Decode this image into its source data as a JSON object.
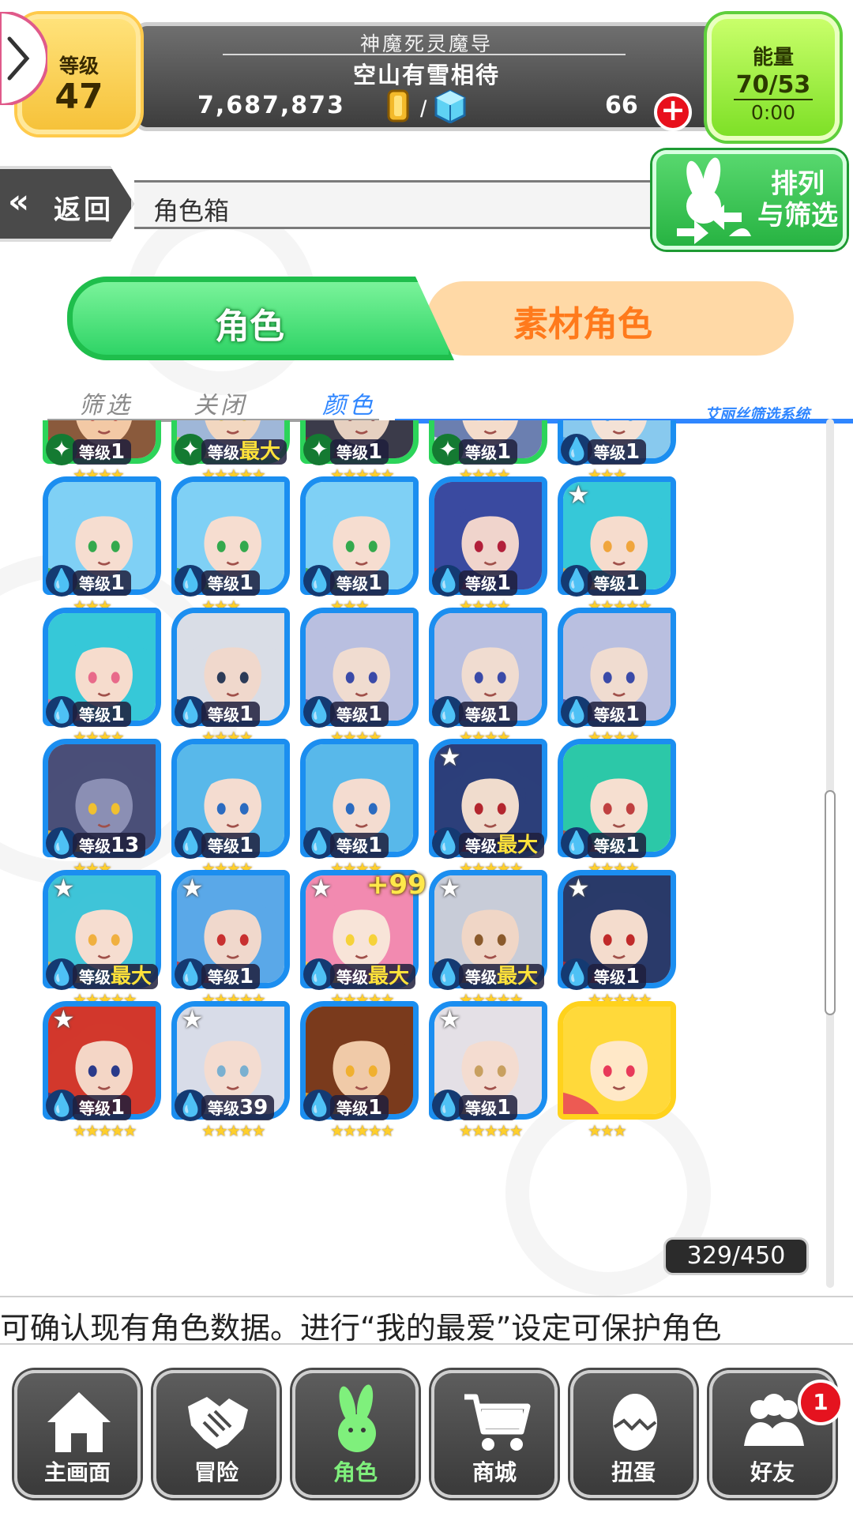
{
  "header": {
    "level_label": "等级",
    "level_value": "47",
    "player_title": "神魔死灵魔导",
    "player_name": "空山有雪相待",
    "coins": "7,687,873",
    "separator": "/",
    "gems": "66",
    "energy_label": "能量",
    "energy_value": "70/53",
    "energy_timer": "0:00"
  },
  "nav_bar": {
    "back_label": "返回",
    "page_title": "角色箱",
    "sort_label_1": "排列",
    "sort_label_2": "与筛选"
  },
  "tabs": {
    "characters": "角色",
    "material": "素材角色"
  },
  "filters": {
    "filter": "筛选",
    "close": "关闭",
    "color": "颜色",
    "system": "艾丽丝筛选系统"
  },
  "units": [
    {
      "lv_label": "等级",
      "lv": "1",
      "stars": "★★★★",
      "frame": "green",
      "elem": "leaf",
      "max": false,
      "rank": false
    },
    {
      "lv_label": "等级",
      "lv": "最大",
      "stars": "★★★★★",
      "frame": "green",
      "elem": "leaf",
      "max": true,
      "rank": false
    },
    {
      "lv_label": "等级",
      "lv": "1",
      "stars": "★★★★★",
      "frame": "green",
      "elem": "leaf",
      "max": false,
      "rank": false
    },
    {
      "lv_label": "等级",
      "lv": "1",
      "stars": "★★★★",
      "frame": "green",
      "elem": "leaf",
      "max": false,
      "rank": false
    },
    {
      "lv_label": "等级",
      "lv": "1",
      "stars": "★★★",
      "frame": "blue",
      "elem": "water",
      "max": false,
      "rank": false
    },
    {
      "lv_label": "等级",
      "lv": "1",
      "stars": "★★★",
      "frame": "blue",
      "elem": "water",
      "max": false,
      "rank": false
    },
    {
      "lv_label": "等级",
      "lv": "1",
      "stars": "★★★",
      "frame": "blue",
      "elem": "water",
      "max": false,
      "rank": false
    },
    {
      "lv_label": "等级",
      "lv": "1",
      "stars": "★★★",
      "frame": "blue",
      "elem": "water",
      "max": false,
      "rank": false
    },
    {
      "lv_label": "等级",
      "lv": "1",
      "stars": "★★★★",
      "frame": "blue",
      "elem": "water",
      "max": false,
      "rank": false
    },
    {
      "lv_label": "等级",
      "lv": "1",
      "stars": "★★★★★",
      "frame": "blue",
      "elem": "water",
      "max": false,
      "rank": true
    },
    {
      "lv_label": "等级",
      "lv": "1",
      "stars": "★★★★",
      "frame": "blue",
      "elem": "water",
      "max": false,
      "rank": false
    },
    {
      "lv_label": "等级",
      "lv": "1",
      "stars": "★★★★",
      "frame": "blue",
      "elem": "water",
      "max": false,
      "rank": false
    },
    {
      "lv_label": "等级",
      "lv": "1",
      "stars": "★★★★",
      "frame": "blue",
      "elem": "water",
      "max": false,
      "rank": false
    },
    {
      "lv_label": "等级",
      "lv": "1",
      "stars": "★★★★",
      "frame": "blue",
      "elem": "water",
      "max": false,
      "rank": false
    },
    {
      "lv_label": "等级",
      "lv": "1",
      "stars": "★★★★",
      "frame": "blue",
      "elem": "water",
      "max": false,
      "rank": false
    },
    {
      "lv_label": "等级",
      "lv": "13",
      "stars": "★★★",
      "frame": "blue",
      "elem": "water",
      "max": false,
      "rank": false
    },
    {
      "lv_label": "等级",
      "lv": "1",
      "stars": "★★★★",
      "frame": "blue",
      "elem": "water",
      "max": false,
      "rank": false
    },
    {
      "lv_label": "等级",
      "lv": "1",
      "stars": "★★★★",
      "frame": "blue",
      "elem": "water",
      "max": false,
      "rank": false
    },
    {
      "lv_label": "等级",
      "lv": "最大",
      "stars": "★★★★★",
      "frame": "blue",
      "elem": "water",
      "max": true,
      "rank": true
    },
    {
      "lv_label": "等级",
      "lv": "1",
      "stars": "★★★★",
      "frame": "blue",
      "elem": "water",
      "max": false,
      "rank": false
    },
    {
      "lv_label": "等级",
      "lv": "最大",
      "stars": "★★★★★",
      "frame": "blue",
      "elem": "water",
      "max": true,
      "rank": true
    },
    {
      "lv_label": "等级",
      "lv": "1",
      "stars": "★★★★★",
      "frame": "blue",
      "elem": "water",
      "max": false,
      "rank": true
    },
    {
      "lv_label": "等级",
      "lv": "最大",
      "stars": "★★★★★",
      "frame": "blue",
      "elem": "water",
      "max": true,
      "rank": true,
      "plus": "+99"
    },
    {
      "lv_label": "等级",
      "lv": "最大",
      "stars": "★★★★★",
      "frame": "blue",
      "elem": "water",
      "max": true,
      "rank": true
    },
    {
      "lv_label": "等级",
      "lv": "1",
      "stars": "★★★★★",
      "frame": "blue",
      "elem": "water",
      "max": false,
      "rank": true
    },
    {
      "lv_label": "等级",
      "lv": "1",
      "stars": "★★★★★",
      "frame": "blue",
      "elem": "water",
      "max": false,
      "rank": true
    },
    {
      "lv_label": "等级",
      "lv": "39",
      "stars": "★★★★★",
      "frame": "blue",
      "elem": "water",
      "max": false,
      "rank": true
    },
    {
      "lv_label": "等级",
      "lv": "1",
      "stars": "★★★★★",
      "frame": "blue",
      "elem": "water",
      "max": false,
      "rank": false
    },
    {
      "lv_label": "等级",
      "lv": "1",
      "stars": "★★★★★",
      "frame": "blue",
      "elem": "water",
      "max": false,
      "rank": true
    },
    {
      "lv_label": "",
      "lv": "",
      "stars": "★★★",
      "frame": "yellow",
      "elem": "none",
      "max": false,
      "rank": false
    }
  ],
  "unit_palettes": [
    [
      "#8a5a3c",
      "#f3c9a5",
      "#c43b2f"
    ],
    [
      "#9fb7d8",
      "#f2d7c0",
      "#e6c25a"
    ],
    [
      "#3b3b4a",
      "#e6d0c0",
      "#7a2c2c"
    ],
    [
      "#6b7fb0",
      "#f4dccb",
      "#e8e8f4"
    ],
    [
      "#88c9ee",
      "#f4e2d6",
      "#4aa0e0"
    ],
    [
      "#7fd0f5",
      "#f6ddd0",
      "#34a94d"
    ],
    [
      "#7fd0f5",
      "#f6ddd0",
      "#34a94d"
    ],
    [
      "#7fd0f5",
      "#f6ddd0",
      "#34a94d"
    ],
    [
      "#3a4aa0",
      "#f0d4cc",
      "#b21f3a"
    ],
    [
      "#36c8d8",
      "#f6dccd",
      "#f0a53c"
    ],
    [
      "#36c8d8",
      "#f6dccd",
      "#e86a8a"
    ],
    [
      "#d9dde6",
      "#f0d8cc",
      "#2c3b58"
    ],
    [
      "#b9bfe0",
      "#f0dcd0",
      "#3a4aa8"
    ],
    [
      "#b9bfe0",
      "#f0dcd0",
      "#3a4aa8"
    ],
    [
      "#b9bfe0",
      "#f0dcd0",
      "#3a4aa8"
    ],
    [
      "#4a4f78",
      "#8b8fb4",
      "#f0c030"
    ],
    [
      "#58b8ea",
      "#f4dcd0",
      "#2b6bc0"
    ],
    [
      "#58b8ea",
      "#f4dcd0",
      "#2b6bc0"
    ],
    [
      "#2c3f7a",
      "#f0dccd",
      "#b3262e"
    ],
    [
      "#2cc8a8",
      "#f6dfd0",
      "#c04040"
    ],
    [
      "#3fc4d8",
      "#f6ddd0",
      "#f0b040"
    ],
    [
      "#5aa8e8",
      "#f0d8cc",
      "#c83030"
    ],
    [
      "#f28ab0",
      "#f8e4d8",
      "#f6d23a"
    ],
    [
      "#c8ccd8",
      "#f0d6c6",
      "#8a5a2c"
    ],
    [
      "#2a3a6a",
      "#f4dccd",
      "#c02a2a"
    ],
    [
      "#d2382c",
      "#f4d6c6",
      "#2a3a8a"
    ],
    [
      "#d8dce8",
      "#f4dcd0",
      "#7ab0d0"
    ],
    [
      "#7a3a1c",
      "#f0caa8",
      "#f0b030"
    ],
    [
      "#e4e0e6",
      "#f4dcd0",
      "#c8a060"
    ],
    [
      "#ffd93a",
      "#ffe8c8",
      "#e83a5a"
    ]
  ],
  "box_count": "329/450",
  "ticker": "可确认现有角色数据。进行“我的最爱”设定可保护角色",
  "bottom_nav": [
    {
      "label": "主画面",
      "icon": "home-icon"
    },
    {
      "label": "冒险",
      "icon": "handshake-icon"
    },
    {
      "label": "角色",
      "icon": "bunny-icon"
    },
    {
      "label": "商城",
      "icon": "cart-icon"
    },
    {
      "label": "扭蛋",
      "icon": "egg-icon"
    },
    {
      "label": "好友",
      "icon": "friends-icon"
    }
  ],
  "friends_badge": "1",
  "colors": {
    "accent_blue": "#1b8ef0",
    "accent_green": "#2cd45a",
    "accent_orange": "#ff7a1c",
    "badge_red": "#e5131f"
  }
}
